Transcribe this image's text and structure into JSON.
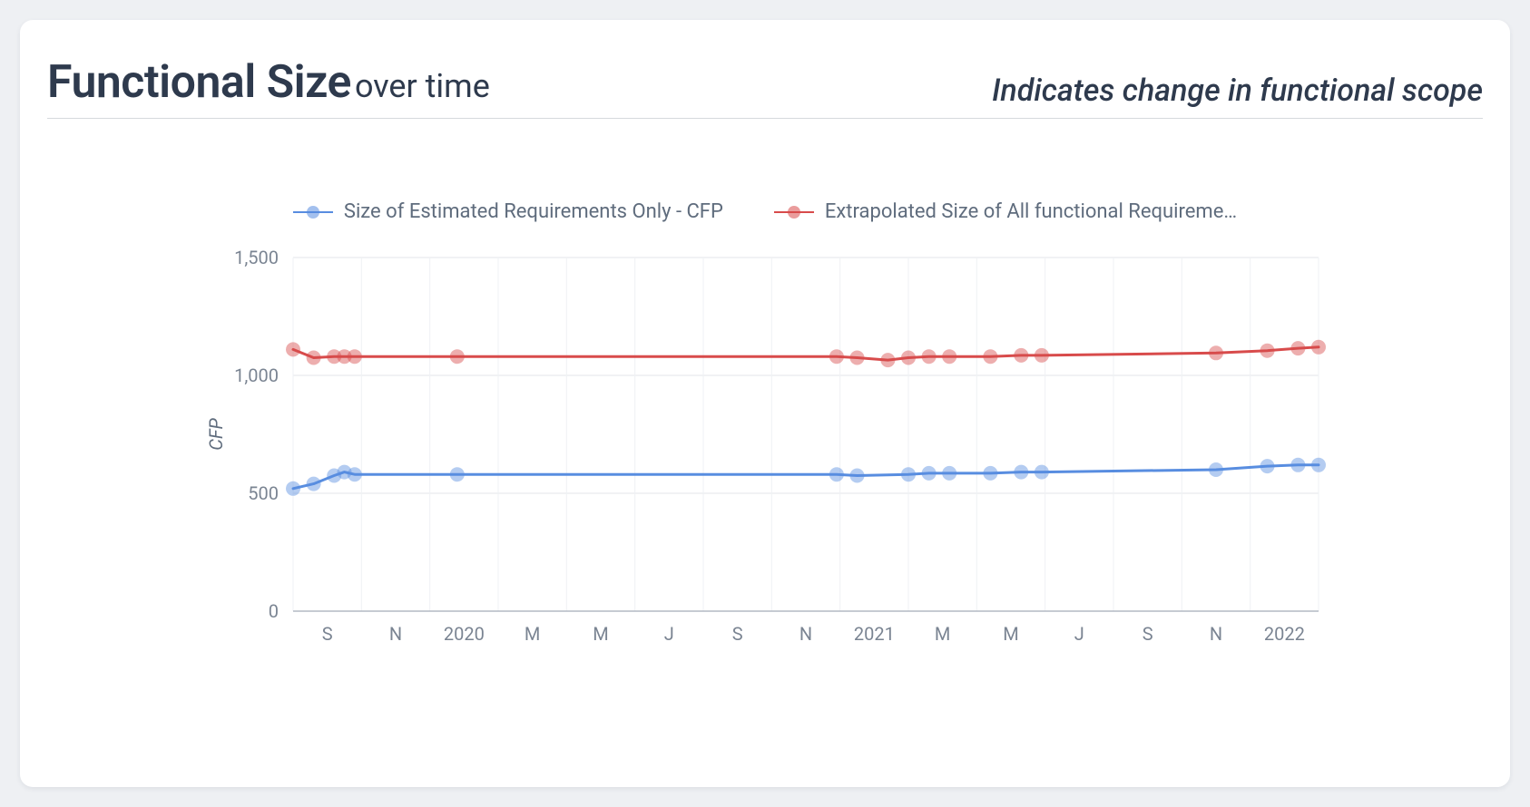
{
  "header": {
    "title_main": "Functional Size",
    "title_sub": "over time",
    "note": "Indicates change in functional scope"
  },
  "chart_data": {
    "type": "line",
    "ylabel": "CFP",
    "xlabel": "",
    "ylim": [
      0,
      1500
    ],
    "y_ticks": [
      0,
      500,
      1000,
      1500
    ],
    "x_tick_labels": [
      "S",
      "N",
      "2020",
      "M",
      "M",
      "J",
      "S",
      "N",
      "2021",
      "M",
      "M",
      "J",
      "S",
      "N",
      "2022"
    ],
    "series": [
      {
        "name": "Size of Estimated Requirements Only - CFP",
        "color": "#588de0",
        "points": [
          {
            "x": 0.0,
            "y": 520
          },
          {
            "x": 0.02,
            "y": 540
          },
          {
            "x": 0.04,
            "y": 575
          },
          {
            "x": 0.05,
            "y": 590
          },
          {
            "x": 0.06,
            "y": 580
          },
          {
            "x": 0.16,
            "y": 580
          },
          {
            "x": 0.53,
            "y": 580
          },
          {
            "x": 0.55,
            "y": 575
          },
          {
            "x": 0.6,
            "y": 580
          },
          {
            "x": 0.62,
            "y": 585
          },
          {
            "x": 0.64,
            "y": 585
          },
          {
            "x": 0.68,
            "y": 585
          },
          {
            "x": 0.71,
            "y": 590
          },
          {
            "x": 0.73,
            "y": 590
          },
          {
            "x": 0.9,
            "y": 600
          },
          {
            "x": 0.95,
            "y": 615
          },
          {
            "x": 0.98,
            "y": 620
          },
          {
            "x": 1.0,
            "y": 620
          }
        ]
      },
      {
        "name": "Extrapolated Size of All functional Requireme…",
        "color": "#d84b4b",
        "points": [
          {
            "x": 0.0,
            "y": 1110
          },
          {
            "x": 0.02,
            "y": 1075
          },
          {
            "x": 0.04,
            "y": 1080
          },
          {
            "x": 0.05,
            "y": 1080
          },
          {
            "x": 0.06,
            "y": 1080
          },
          {
            "x": 0.16,
            "y": 1080
          },
          {
            "x": 0.53,
            "y": 1080
          },
          {
            "x": 0.55,
            "y": 1075
          },
          {
            "x": 0.58,
            "y": 1065
          },
          {
            "x": 0.6,
            "y": 1075
          },
          {
            "x": 0.62,
            "y": 1080
          },
          {
            "x": 0.64,
            "y": 1080
          },
          {
            "x": 0.68,
            "y": 1080
          },
          {
            "x": 0.71,
            "y": 1085
          },
          {
            "x": 0.73,
            "y": 1085
          },
          {
            "x": 0.9,
            "y": 1095
          },
          {
            "x": 0.95,
            "y": 1105
          },
          {
            "x": 0.98,
            "y": 1115
          },
          {
            "x": 1.0,
            "y": 1120
          }
        ]
      }
    ]
  }
}
